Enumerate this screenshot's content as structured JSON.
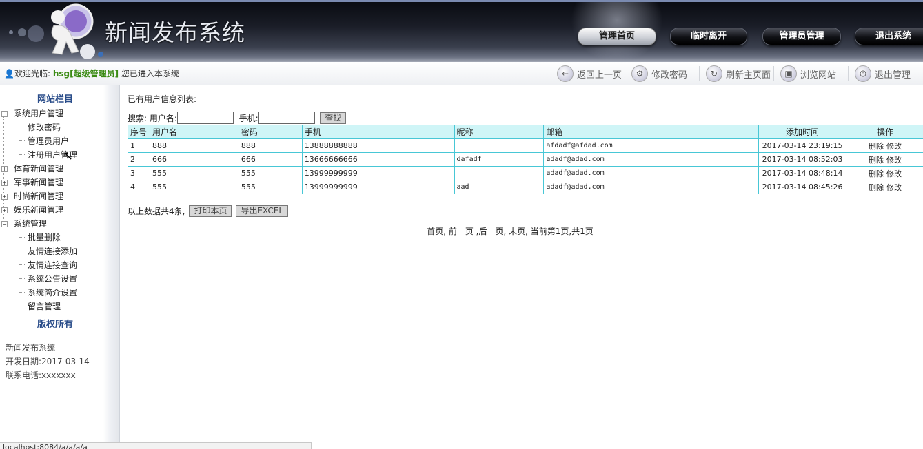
{
  "header": {
    "title": "新闻发布系统",
    "nav": [
      "管理首页",
      "临时离开",
      "管理员管理",
      "退出系统"
    ],
    "active_nav": "管理首页"
  },
  "toolbar": {
    "welcome_prefix": "欢迎光临:",
    "user": "hsg[超级管理员]",
    "welcome_suffix": "您已进入本系统",
    "buttons": [
      {
        "label": "返回上一页",
        "icon": "back-arrow-icon"
      },
      {
        "label": "修改密码",
        "icon": "key-icon"
      },
      {
        "label": "刷新主页面",
        "icon": "refresh-icon"
      },
      {
        "label": "浏览网站",
        "icon": "monitor-icon"
      },
      {
        "label": "退出管理",
        "icon": "power-icon"
      }
    ]
  },
  "sidebar": {
    "title": "网站栏目",
    "tree": [
      {
        "label": "系统用户管理",
        "expanded": true,
        "children": [
          "修改密码",
          "管理员用户",
          "注册用户管理"
        ]
      },
      {
        "label": "体育新闻管理",
        "expanded": false
      },
      {
        "label": "军事新闻管理",
        "expanded": false
      },
      {
        "label": "时尚新闻管理",
        "expanded": false
      },
      {
        "label": "娱乐新闻管理",
        "expanded": false
      },
      {
        "label": "系统管理",
        "expanded": true,
        "children": [
          "批量删除",
          "友情连接添加",
          "友情连接查询",
          "系统公告设置",
          "系统简介设置",
          "留言管理"
        ]
      }
    ],
    "copyright_title": "版权所有",
    "info": {
      "name": "新闻发布系统",
      "dev_date_label": "开发日期:",
      "dev_date": "2017-03-14",
      "phone_label": "联系电话:",
      "phone": "xxxxxxx"
    }
  },
  "main": {
    "list_title": "已有用户信息列表:",
    "search": {
      "label": "搜索:",
      "username_label": "用户名:",
      "username_value": "",
      "phone_label": "手机:",
      "phone_value": "",
      "button": "查找"
    },
    "table": {
      "columns": [
        "序号",
        "用户名",
        "密码",
        "手机",
        "昵称",
        "邮箱",
        "添加时间",
        "操作"
      ],
      "rows": [
        [
          "1",
          "888",
          "888",
          "13888888888",
          "",
          "afdadf@afdad.com",
          "2017-03-14 23:19:15"
        ],
        [
          "2",
          "666",
          "666",
          "13666666666",
          "dafadf",
          "adadf@adad.com",
          "2017-03-14 08:52:03"
        ],
        [
          "3",
          "555",
          "555",
          "13999999999",
          "",
          "adadf@adad.com",
          "2017-03-14 08:48:14"
        ],
        [
          "4",
          "555",
          "555",
          "13999999999",
          "aad",
          "adadf@adad.com",
          "2017-03-14 08:45:26"
        ]
      ],
      "op_delete": "删除",
      "op_edit": "修改"
    },
    "summary": "以上数据共4条,",
    "print_button": "打印本页",
    "export_button": "导出EXCEL",
    "pager": "首页, 前一页 ,后一页, 末页, 当前第1页,共1页"
  },
  "status_bar": "localhost:8084/a/a/a/a"
}
